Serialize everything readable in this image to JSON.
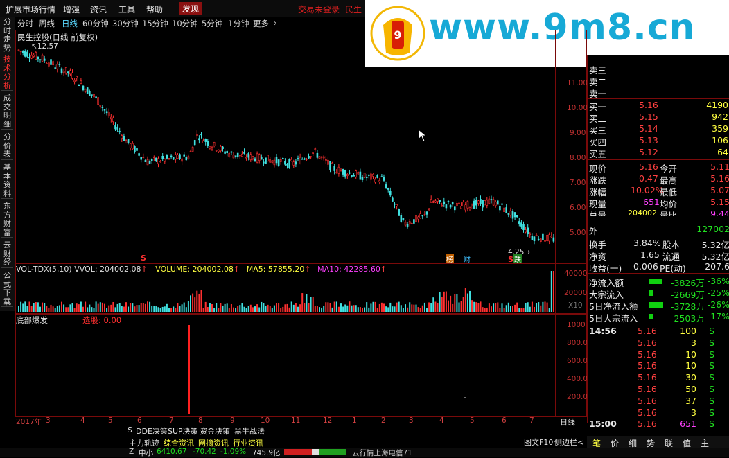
{
  "menu": {
    "items": [
      "扩展市场行情",
      "增强",
      "资讯",
      "工具",
      "帮助"
    ],
    "active": "发现",
    "login": "交易未登录",
    "broker": "民生"
  },
  "watermark": {
    "text": "www.9m8.cn",
    "logo_text": "www.9m8.cn"
  },
  "periods": [
    "分时",
    "周线",
    "日线",
    "60分钟",
    "30分钟",
    "15分钟",
    "10分钟",
    "5分钟",
    "1分钟",
    "更多",
    "›"
  ],
  "period_selected": "日线",
  "vtabs": [
    "分时走势",
    "技术分析",
    "成交明细",
    "分价表",
    "基本资料",
    "东方财富",
    "云财经",
    "公式下载"
  ],
  "vtab_selected": "技术分析",
  "main_chart": {
    "title": "民生控股(日线 前复权)",
    "high_label": "12.57",
    "low_label": "4.25",
    "y_ticks": [
      "11.00",
      "10.00",
      "9.00",
      "8.00",
      "7.00",
      "6.00",
      "5.00"
    ],
    "markers": [
      "S",
      "榜",
      "财",
      "S",
      "跌"
    ]
  },
  "volume": {
    "indicator": "VOL-TDX(5,10)",
    "vvol": "VVOL: 204002.08",
    "volume": "VOLUME: 204002.08",
    "ma5": "MA5: 57855.20",
    "ma10": "MA10: 42285.60",
    "y_ticks": [
      "40000",
      "20000"
    ],
    "x10": "X10"
  },
  "bottom_chart": {
    "name": "底部爆发",
    "select_label": "选股: 0.00",
    "y_ticks": [
      "1000",
      "800.00",
      "600.00",
      "400.00",
      "200.00"
    ]
  },
  "x_axis": [
    "2017年",
    "3",
    "4",
    "5",
    "6",
    "7",
    "8",
    "9",
    "10",
    "11",
    "12",
    "1",
    "2",
    "3",
    "4",
    "5",
    "6",
    "7"
  ],
  "x_axis_period": "日线",
  "quote": {
    "sell": [
      {
        "label": "卖三"
      },
      {
        "label": "卖二"
      },
      {
        "label": "卖一"
      }
    ],
    "buy": [
      {
        "label": "买一",
        "price": "5.16",
        "vol": "4190"
      },
      {
        "label": "买二",
        "price": "5.15",
        "vol": "942"
      },
      {
        "label": "买三",
        "price": "5.14",
        "vol": "359"
      },
      {
        "label": "买四",
        "price": "5.13",
        "vol": "106"
      },
      {
        "label": "买五",
        "price": "5.12",
        "vol": "64"
      }
    ],
    "stats": [
      {
        "l1": "现价",
        "v1": "5.16",
        "l2": "今开",
        "v2": "5.11"
      },
      {
        "l1": "涨跌",
        "v1": "0.47",
        "l2": "最高",
        "v2": "5.16"
      },
      {
        "l1": "涨幅",
        "v1": "10.02%",
        "l2": "最低",
        "v2": "5.07"
      },
      {
        "l1": "现量",
        "v1": "651",
        "l2": "均价",
        "v2": "5.15"
      },
      {
        "l1": "总量",
        "v1": "204002",
        "l2": "量比",
        "v2": "9.44"
      }
    ],
    "outer_label": "外",
    "outer_value": "127002",
    "fin": [
      {
        "l1": "换手",
        "v1": "3.84%",
        "l2": "股本",
        "v2": "5.32亿"
      },
      {
        "l1": "净资",
        "v1": "1.65",
        "l2": "流通",
        "v2": "5.32亿"
      },
      {
        "l1": "收益(一)",
        "v1": "0.006",
        "l2": "PE(动)",
        "v2": "207.6"
      }
    ],
    "flows": [
      {
        "label": "净流入额",
        "value": "-3826万",
        "pct": "-36%",
        "bar": 0.72
      },
      {
        "label": "大宗流入",
        "value": "-2669万",
        "pct": "-25%",
        "bar": 0.2
      },
      {
        "label": "5日净流入额",
        "value": "-3728万",
        "pct": "-26%",
        "bar": 0.74
      },
      {
        "label": "5日大宗流入",
        "value": "-2503万",
        "pct": "-17%",
        "bar": 0.2
      }
    ],
    "ticks": [
      {
        "time": "14:56",
        "price": "5.16",
        "vol": "100",
        "side": "S"
      },
      {
        "time": "",
        "price": "5.16",
        "vol": "3",
        "side": "S"
      },
      {
        "time": "",
        "price": "5.16",
        "vol": "10",
        "side": "S"
      },
      {
        "time": "",
        "price": "5.16",
        "vol": "10",
        "side": "S"
      },
      {
        "time": "",
        "price": "5.16",
        "vol": "30",
        "side": "S"
      },
      {
        "time": "",
        "price": "5.16",
        "vol": "50",
        "side": "S"
      },
      {
        "time": "",
        "price": "5.16",
        "vol": "37",
        "side": "S"
      },
      {
        "time": "",
        "price": "5.16",
        "vol": "3",
        "side": "S"
      },
      {
        "time": "15:00",
        "price": "5.16",
        "vol": "651",
        "side": "S"
      }
    ]
  },
  "bottom_tabs_row1": [
    "S",
    "DDE决策",
    "SUP决策",
    "资金决策",
    "黑牛战法"
  ],
  "bottom_tabs_row2": [
    "主力轨迹",
    "综合资讯",
    "网摘资讯",
    "行业资讯"
  ],
  "right_buttons": [
    "笔",
    "价",
    "细",
    "势",
    "联",
    "值",
    "主"
  ],
  "footer_right": [
    "图文F10",
    "侧边栏<"
  ],
  "status": {
    "index": "中小",
    "value": "6410.67",
    "chg": "-70.42",
    "pct": "-1.09%",
    "amount": "745.9亿",
    "news": "云行情上海电信71"
  }
}
